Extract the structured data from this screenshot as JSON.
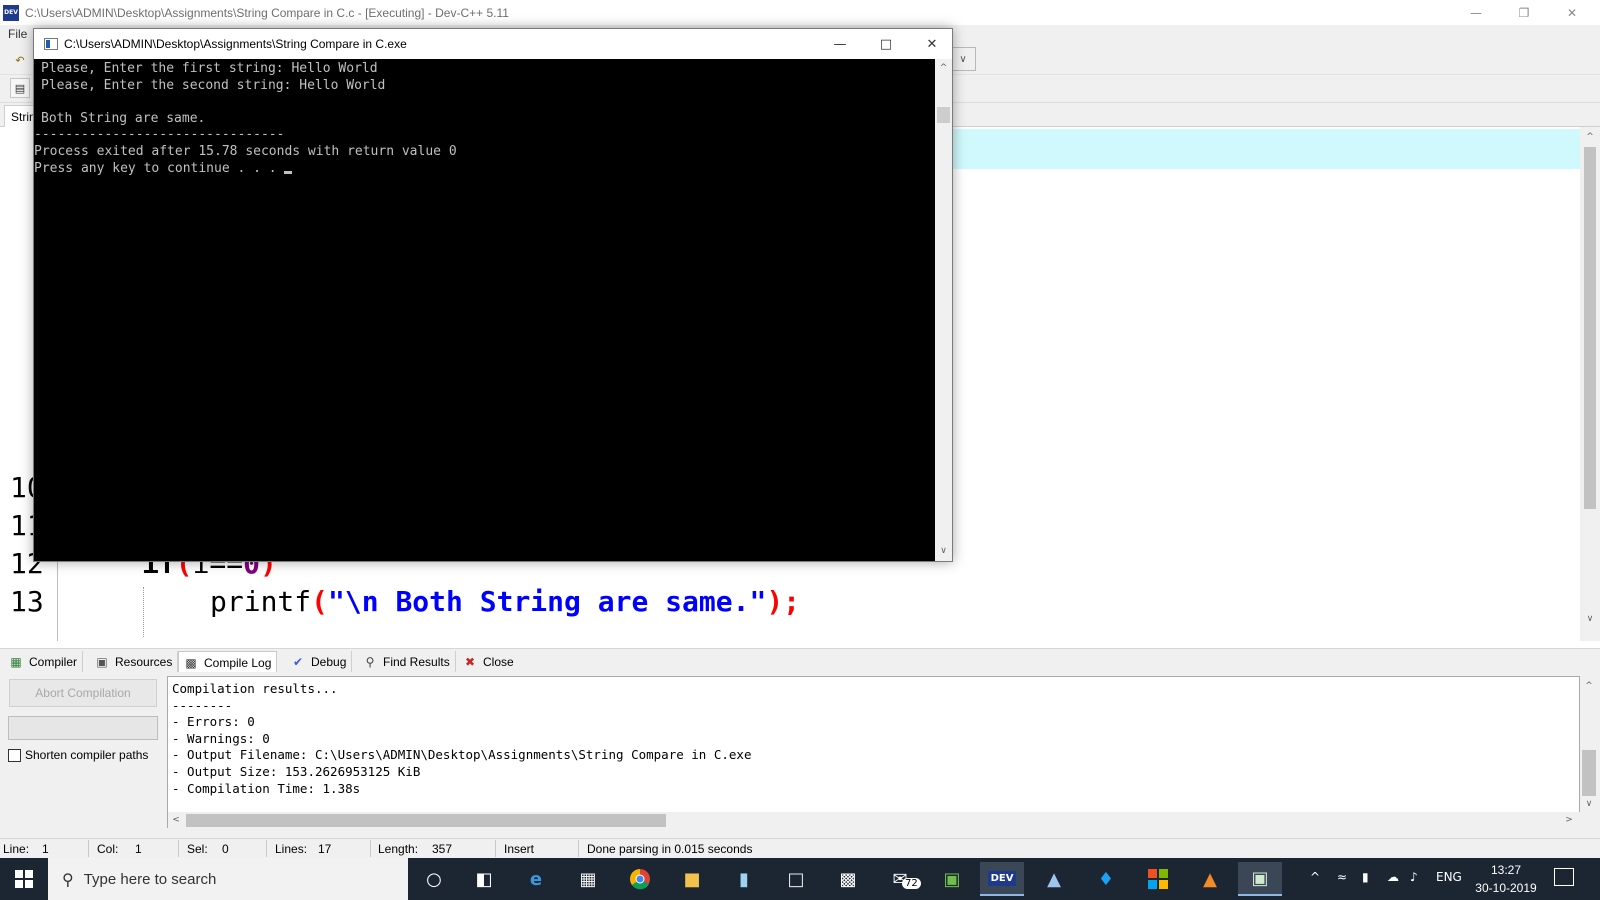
{
  "ide": {
    "title": "C:\\Users\\ADMIN\\Desktop\\Assignments\\String Compare in C.c - [Executing] - Dev-C++ 5.11",
    "app_icon_text": "DEV",
    "menu_file": "File",
    "editor_tab": "Strin"
  },
  "editor": {
    "line_numbers": [
      "10",
      "11",
      "12",
      "13"
    ],
    "line12": {
      "kw": "if",
      "open": "(",
      "var": "i==",
      "num": "0",
      "close": ")"
    },
    "line13": {
      "fn": "printf",
      "open": "(",
      "str": "\"\\n Both String are same.\"",
      "close": ");"
    }
  },
  "console": {
    "title": "C:\\Users\\ADMIN\\Desktop\\Assignments\\String Compare in C.exe",
    "lines": [
      "Please, Enter the first string: Hello World",
      "Please, Enter the second string: Hello World",
      "",
      "Both String are same."
    ],
    "separator": "--------------------------------",
    "exit_line": "Process exited after 15.78 seconds with return value 0",
    "continue_line": "Press any key to continue . . . "
  },
  "bottom_tabs": [
    "Compiler",
    "Resources",
    "Compile Log",
    "Debug",
    "Find Results",
    "Close"
  ],
  "compile_panel": {
    "abort_label": "Abort Compilation",
    "shorten_label": "Shorten compiler paths",
    "shorten_checked": false,
    "log_lines": [
      "Compilation results...",
      "--------",
      "- Errors: 0",
      "- Warnings: 0",
      "- Output Filename: C:\\Users\\ADMIN\\Desktop\\Assignments\\String Compare in C.exe",
      "- Output Size: 153.2626953125 KiB",
      "- Compilation Time: 1.38s"
    ]
  },
  "status": {
    "line_label": "Line:",
    "line_value": "1",
    "col_label": "Col:",
    "col_value": "1",
    "sel_label": "Sel:",
    "sel_value": "0",
    "lines_label": "Lines:",
    "lines_value": "17",
    "length_label": "Length:",
    "length_value": "357",
    "mode": "Insert",
    "message": "Done parsing in 0.015 seconds"
  },
  "taskbar": {
    "search_placeholder": "Type here to search",
    "mail_badge": "72",
    "language": "ENG",
    "time": "13:27",
    "date": "30-10-2019",
    "dev_icon_text": "DEV"
  },
  "colors": {
    "current_line": "#cff9fc",
    "console_bg": "#000000",
    "console_fg": "#c0c0c0",
    "taskbar_bg": "#1c2633",
    "keyword_paren": "#ff0000",
    "string": "#0000ff",
    "number": "#800080"
  }
}
